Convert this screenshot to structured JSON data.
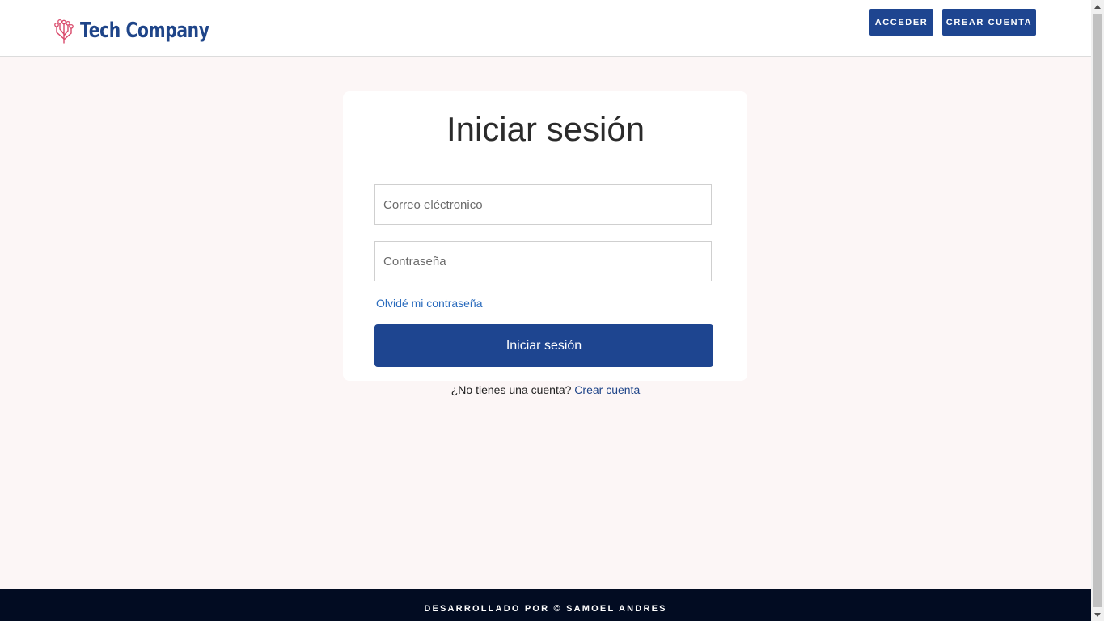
{
  "header": {
    "brand": "Tech Company",
    "logo_icon": "circuit-icon",
    "nav": {
      "login_label": "Acceder",
      "signup_label": "Crear cuenta"
    }
  },
  "login": {
    "title": "Iniciar sesión",
    "email_placeholder": "Correo eléctronico",
    "password_placeholder": "Contraseña",
    "forgot_label": "Olvidé mi contraseña",
    "submit_label": "Iniciar sesión",
    "no_account_text": "¿No tienes una cuenta?",
    "signup_link_label": "Crear cuenta"
  },
  "footer": {
    "text": "Desarrollado por © Samoel Andres"
  },
  "colors": {
    "brand_blue": "#1e4590",
    "link_blue": "#2a6bbd",
    "page_bg": "#fcf6f6",
    "footer_bg": "#020c22",
    "logo_pink": "#d94a6b"
  }
}
